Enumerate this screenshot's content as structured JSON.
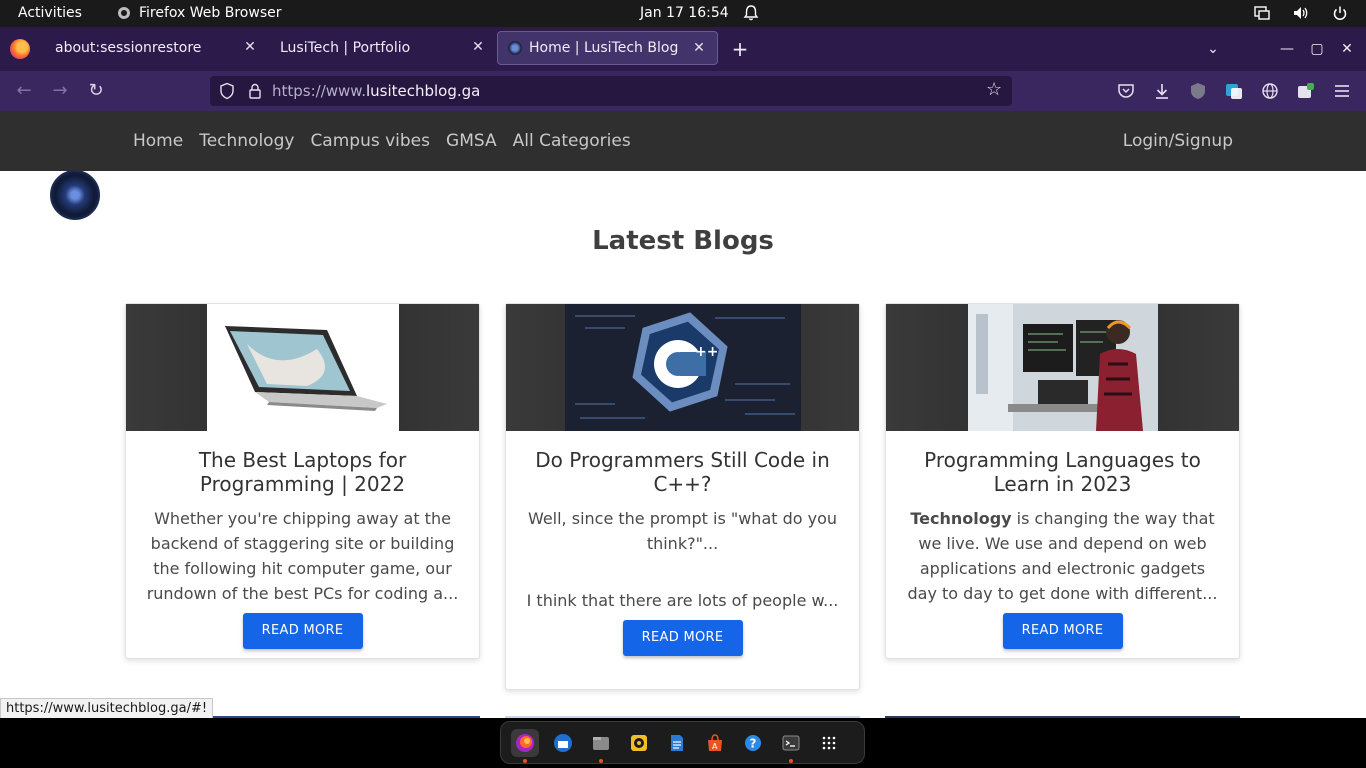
{
  "system": {
    "activities": "Activities",
    "app_name": "Firefox Web Browser",
    "datetime": "Jan 17  16:54"
  },
  "tabs": [
    {
      "label": "about:sessionrestore",
      "active": false
    },
    {
      "label": "LusiTech | Portfolio",
      "active": false
    },
    {
      "label": "Home | LusiTech Blog",
      "active": true
    }
  ],
  "address": {
    "prefix": "https://www.",
    "domain": "lusitechblog.ga"
  },
  "site_nav": {
    "links": [
      "Home",
      "Technology",
      "Campus vibes",
      "GMSA",
      "All Categories"
    ],
    "login": "Login/Signup"
  },
  "section_title": "Latest Blogs",
  "cards": [
    {
      "title": "The Best Laptops for Programming | 2022",
      "excerpt": "Whether you're chipping away at the backend of staggering site or building the following hit computer game, our rundown of the best PCs for coding a...",
      "button": "READ MORE"
    },
    {
      "title": "Do Programmers Still Code in C++?",
      "excerpt_line1": "Well, since the prompt is \"what do you think?\"...",
      "excerpt_line2": "I think that there are lots of people w...",
      "button": "READ MORE"
    },
    {
      "title": "Programming Languages to Learn in 2023",
      "excerpt_bold": "Technology",
      "excerpt_rest": " is changing the way that we live. We use and depend on web applications and electronic gadgets day to day to get done with different...",
      "button": "READ MORE"
    }
  ],
  "status_url": "https://www.lusitechblog.ga/#!",
  "colors": {
    "tabstrip": "#2b1a4a",
    "navbar": "#3a2760",
    "site_header": "#2f2f2f",
    "button": "#1565e8"
  },
  "dock_apps": [
    "firefox-icon",
    "thunderbird-icon",
    "files-icon",
    "rhythmbox-icon",
    "writer-icon",
    "software-icon",
    "help-icon",
    "terminal-icon",
    "app-grid-icon"
  ]
}
